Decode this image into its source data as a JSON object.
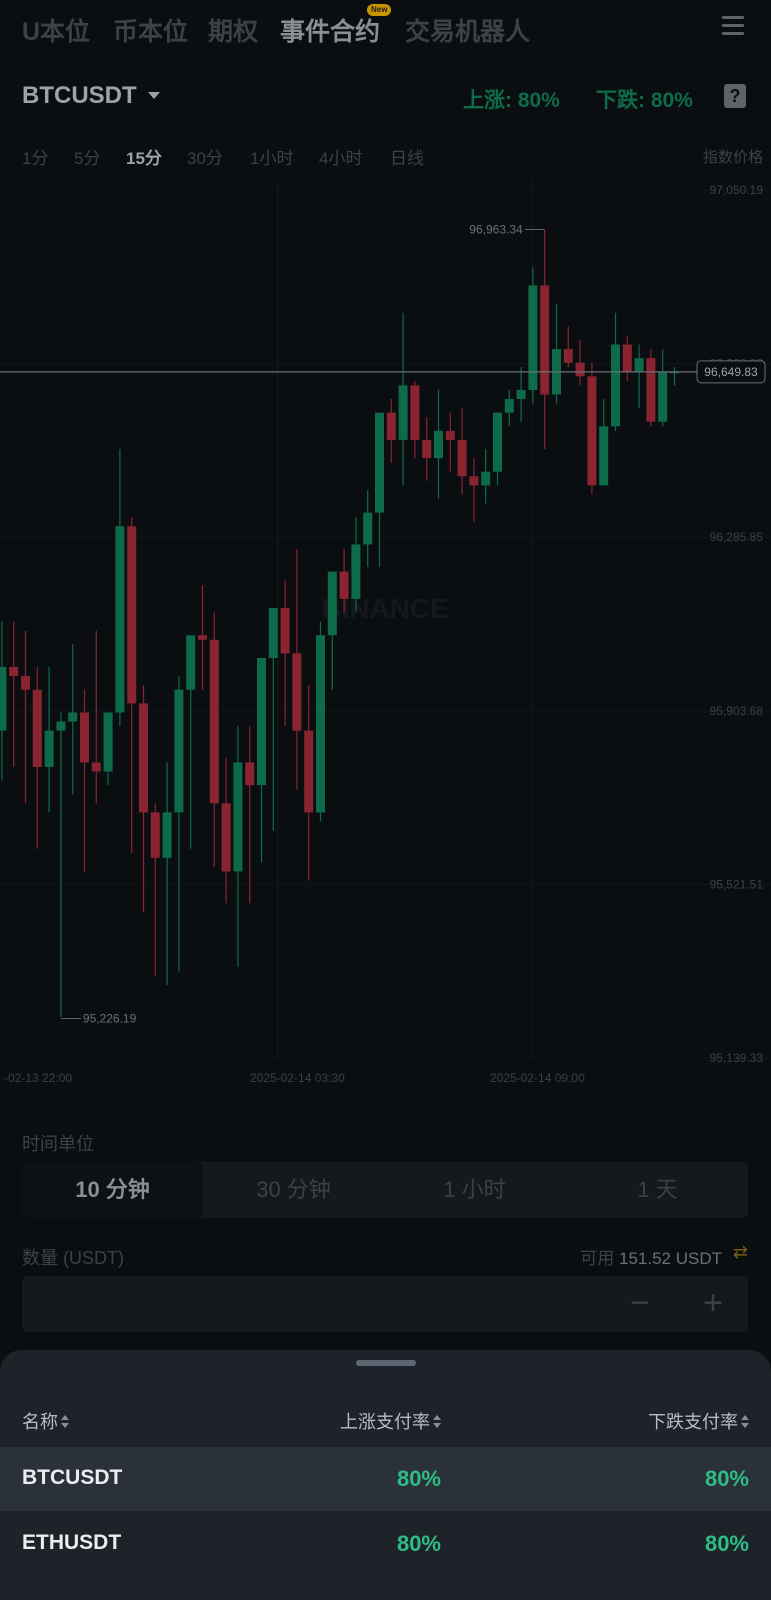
{
  "nav": {
    "tabs": [
      "U本位",
      "币本位",
      "期权",
      "事件合约",
      "交易机器人"
    ],
    "active_tab": "事件合约",
    "new_badge": "New"
  },
  "symbol_bar": {
    "symbol": "BTCUSDT",
    "up_rate": "上涨: 80%",
    "down_rate": "下跌: 80%",
    "help_icon": "help-icon"
  },
  "intervals": {
    "items": [
      "1分",
      "5分",
      "15分",
      "30分",
      "1小时",
      "4小时",
      "日线"
    ],
    "active": "15分",
    "price_type": "指数价格"
  },
  "chart_data": {
    "type": "candlestick",
    "watermark": "BINANCE",
    "y_ticks": [
      "97,050.19",
      "96,668.02",
      "96,285.85",
      "95,903.68",
      "95,521.51",
      "95,139.33"
    ],
    "ylim": [
      95139.33,
      97050.19
    ],
    "x_ticks": [
      "-02-13 22:00",
      "2025-02-14 03:30",
      "2025-02-14 09:00"
    ],
    "current_price": "96,649.83",
    "current_price_value": 96649.83,
    "high_label": "96,963.34",
    "high_value": 96963.34,
    "low_label": "95,226.19",
    "low_value": 95226.19,
    "colors": {
      "up": "#0e6b49",
      "down": "#8a2430"
    },
    "candles": [
      [
        95860,
        96100,
        95750,
        96000
      ],
      [
        96000,
        96100,
        95780,
        95980
      ],
      [
        95980,
        96080,
        95700,
        95950
      ],
      [
        95950,
        96000,
        95600,
        95780
      ],
      [
        95780,
        96000,
        95680,
        95860
      ],
      [
        95860,
        95900,
        95230,
        95880
      ],
      [
        95880,
        96050,
        95720,
        95900
      ],
      [
        95900,
        95950,
        95550,
        95790
      ],
      [
        95790,
        96080,
        95700,
        95770
      ],
      [
        95770,
        95900,
        95740,
        95900
      ],
      [
        95900,
        96480,
        95870,
        96310
      ],
      [
        96310,
        96330,
        95590,
        95920
      ],
      [
        95920,
        95960,
        95460,
        95680
      ],
      [
        95680,
        95700,
        95320,
        95580
      ],
      [
        95580,
        95790,
        95300,
        95680
      ],
      [
        95680,
        95980,
        95330,
        95950
      ],
      [
        95950,
        96020,
        95600,
        96070
      ],
      [
        96070,
        96180,
        95950,
        96060
      ],
      [
        96060,
        96120,
        95560,
        95700
      ],
      [
        95700,
        95800,
        95480,
        95550
      ],
      [
        95550,
        95870,
        95340,
        95790
      ],
      [
        95790,
        95870,
        95480,
        95740
      ],
      [
        95740,
        95800,
        95570,
        96020
      ],
      [
        96020,
        96110,
        95640,
        96130
      ],
      [
        96130,
        96190,
        95870,
        96030
      ],
      [
        96030,
        96260,
        95730,
        95860
      ],
      [
        95860,
        95960,
        95530,
        95680
      ],
      [
        95680,
        96100,
        95660,
        96070
      ],
      [
        96070,
        96110,
        95950,
        96210
      ],
      [
        96210,
        96260,
        96120,
        96150
      ],
      [
        96150,
        96330,
        96120,
        96270
      ],
      [
        96270,
        96390,
        96220,
        96340
      ],
      [
        96340,
        96470,
        96220,
        96560
      ],
      [
        96560,
        96590,
        96450,
        96500
      ],
      [
        96500,
        96780,
        96400,
        96620
      ],
      [
        96620,
        96630,
        96460,
        96500
      ],
      [
        96500,
        96550,
        96410,
        96460
      ],
      [
        96460,
        96610,
        96370,
        96520
      ],
      [
        96520,
        96560,
        96430,
        96500
      ],
      [
        96500,
        96570,
        96380,
        96420
      ],
      [
        96420,
        96460,
        96320,
        96400
      ],
      [
        96400,
        96480,
        96360,
        96430
      ],
      [
        96430,
        96550,
        96400,
        96560
      ],
      [
        96560,
        96610,
        96530,
        96590
      ],
      [
        96590,
        96660,
        96540,
        96610
      ],
      [
        96610,
        96880,
        96580,
        96840
      ],
      [
        96840,
        96963,
        96480,
        96600
      ],
      [
        96600,
        96800,
        96580,
        96700
      ],
      [
        96700,
        96750,
        96660,
        96670
      ],
      [
        96670,
        96720,
        96620,
        96640
      ],
      [
        96640,
        96670,
        96380,
        96400
      ],
      [
        96400,
        96590,
        96400,
        96530
      ],
      [
        96530,
        96780,
        96520,
        96710
      ],
      [
        96710,
        96730,
        96630,
        96650
      ],
      [
        96650,
        96710,
        96570,
        96680
      ],
      [
        96680,
        96700,
        96530,
        96540
      ],
      [
        96540,
        96700,
        96530,
        96650
      ],
      [
        96650,
        96660,
        96620,
        96650
      ]
    ]
  },
  "time_unit": {
    "label": "时间单位",
    "options": [
      "10 分钟",
      "30 分钟",
      "1 小时",
      "1 天"
    ],
    "active": "10 分钟"
  },
  "quantity": {
    "label": "数量 (USDT)",
    "available_label": "可用",
    "available_value": "151.52 USDT",
    "minus": "−",
    "plus": "+"
  },
  "sheet": {
    "headers": {
      "name": "名称",
      "up": "上涨支付率",
      "down": "下跌支付率"
    },
    "rows": [
      {
        "name": "BTCUSDT",
        "up": "80%",
        "down": "80%"
      },
      {
        "name": "ETHUSDT",
        "up": "80%",
        "down": "80%"
      }
    ]
  }
}
